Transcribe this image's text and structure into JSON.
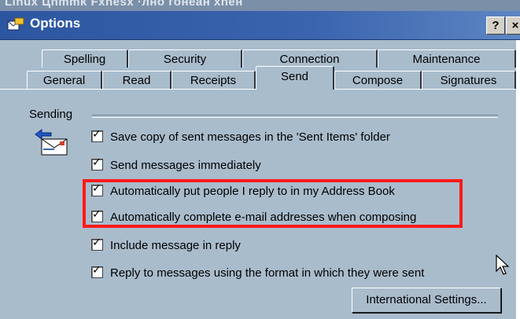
{
  "window": {
    "background_title": "Linux  Цnmmk Fxhesx  ·лно гонеан xneн",
    "title": "Options",
    "help_label": "?",
    "close_label": "×"
  },
  "tabs_back": [
    "Spelling",
    "Security",
    "Connection",
    "Maintenance"
  ],
  "tabs_front": [
    "General",
    "Read",
    "Receipts",
    "Send",
    "Compose",
    "Signatures"
  ],
  "selected_tab": "Send",
  "section": {
    "label": "Sending"
  },
  "options": [
    {
      "label": "Save copy of sent messages in the 'Sent Items' folder",
      "checked": true
    },
    {
      "label": "Send messages immediately",
      "checked": true
    },
    {
      "label": "Automatically put people I reply to in my Address Book",
      "checked": true
    },
    {
      "label": "Automatically complete e-mail addresses when composing",
      "checked": true
    },
    {
      "label": "Include message in reply",
      "checked": true
    },
    {
      "label": "Reply to messages using the format in which they were sent",
      "checked": true
    }
  ],
  "buttons": {
    "international": "International Settings..."
  },
  "colors": {
    "panel": "#a9bccc",
    "titlebar": "#2d56a0",
    "highlight": "#ff1a1a"
  },
  "icons": {
    "window": "options-window-icon",
    "send": "send-mail-icon",
    "cursor": "mouse-pointer-icon"
  }
}
